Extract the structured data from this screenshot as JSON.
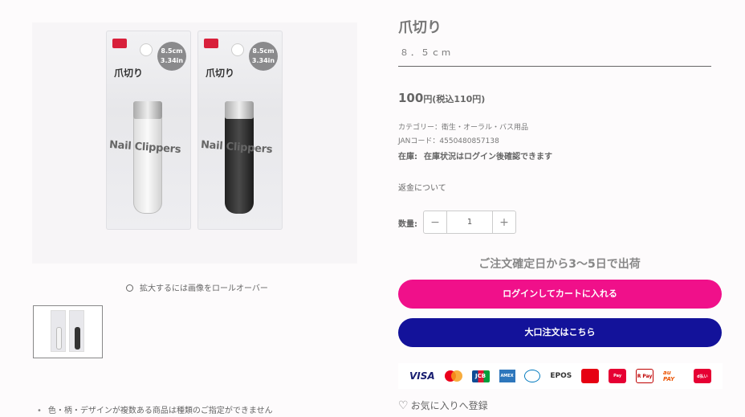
{
  "gallery": {
    "package_label": "爪切り",
    "package_size": "8.5cm 3.34in",
    "package_product": "Nail Clippers",
    "zoom_hint": "拡大するには画像をロールオーバー",
    "thumbnail_alt": "爪切り サムネイル"
  },
  "product": {
    "title": "爪切り",
    "subtitle": "８．５ｃｍ",
    "price_main": "100",
    "price_suffix": "円(税込110円)",
    "category": "カテゴリー：衛生・オーラル・バス用品",
    "jan": "JANコード：4550480857138",
    "stock_label": "在庫:",
    "stock_value": "在庫状況はログイン後確認できます",
    "refund_link": "返金について"
  },
  "quantity": {
    "label": "数量:",
    "value": "1",
    "minus": "−",
    "plus": "+"
  },
  "shipping": "ご注文確定日から3〜5日で出荷",
  "buttons": {
    "cart": "ログインしてカートに入れる",
    "bulk": "大口注文はこちら"
  },
  "payments": [
    "VISA",
    "Mastercard",
    "JCB",
    "AMEX",
    "Diners Club",
    "EPOS",
    "PayPay",
    "Pay",
    "R Pay",
    "au PAY",
    "d払い"
  ],
  "favorite": "お気に入りへ登録",
  "note": "色・柄・デザインが複数ある商品は種類のご指定ができません",
  "colors": {
    "cart_button": "#f0108a",
    "bulk_button": "#13129a"
  }
}
